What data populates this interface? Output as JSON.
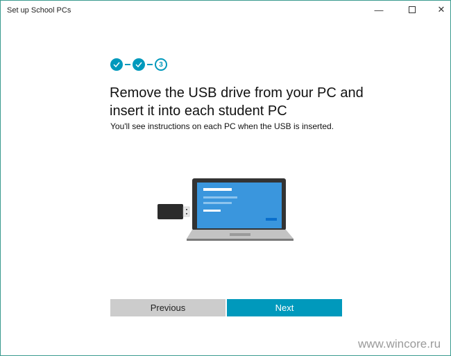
{
  "window": {
    "title": "Set up School PCs",
    "minimize_icon": "minimize-icon",
    "maximize_icon": "maximize-icon",
    "close_icon": "close-icon"
  },
  "steps": {
    "completed": [
      1,
      2
    ],
    "current": "3"
  },
  "main": {
    "heading": "Remove the USB drive from your PC and insert it into each student PC",
    "subtitle": "You'll see instructions on each PC when the USB is inserted."
  },
  "buttons": {
    "previous": "Previous",
    "next": "Next"
  },
  "watermark": "www.wincore.ru",
  "colors": {
    "accent": "#0099bc",
    "screen": "#3a96dd",
    "border": "#3a9a8e"
  }
}
